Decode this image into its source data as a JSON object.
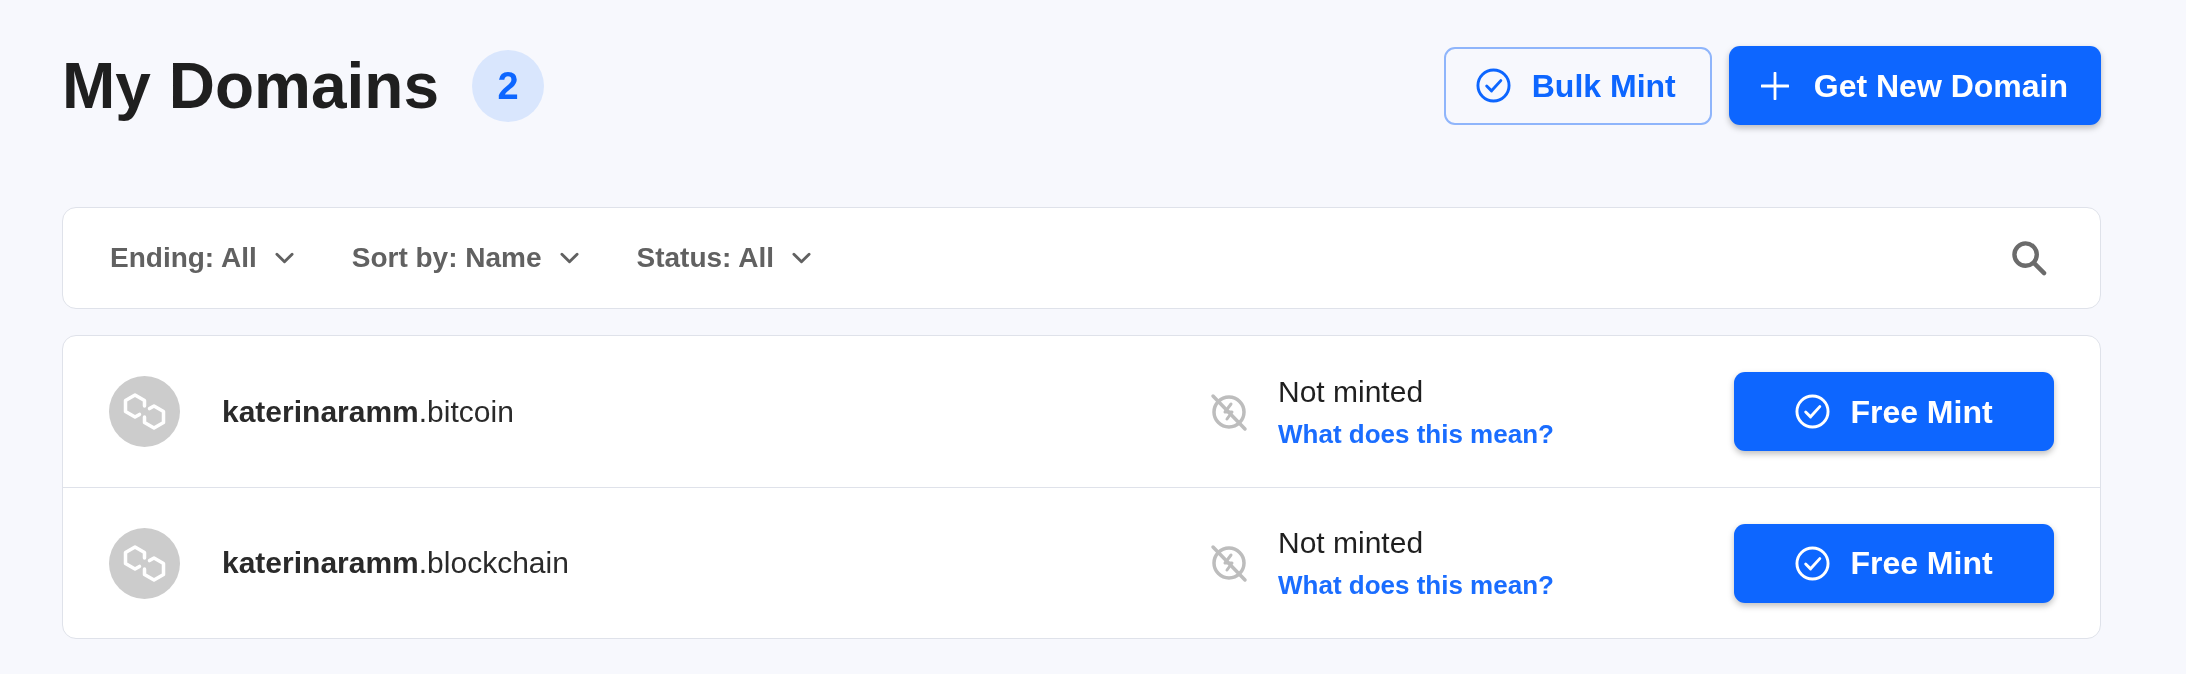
{
  "header": {
    "title": "My Domains",
    "count": "2"
  },
  "actions": [
    {
      "kind": "outline",
      "label": "Bulk Mint"
    },
    {
      "kind": "primary",
      "label": "Get New Domain"
    }
  ],
  "filters": [
    {
      "label": "Ending: All"
    },
    {
      "label": "Sort by: Name"
    },
    {
      "label": "Status: All"
    }
  ],
  "domains": [
    {
      "name": "**katerinaramm**.bitcoin",
      "status": "Not minted",
      "help_link": "What does this mean?",
      "action": "Free Mint"
    },
    {
      "name": "**katerinaramm**.blockchain",
      "status": "Not minted",
      "help_link": "What does this mean?",
      "action": "Free Mint"
    }
  ]
}
